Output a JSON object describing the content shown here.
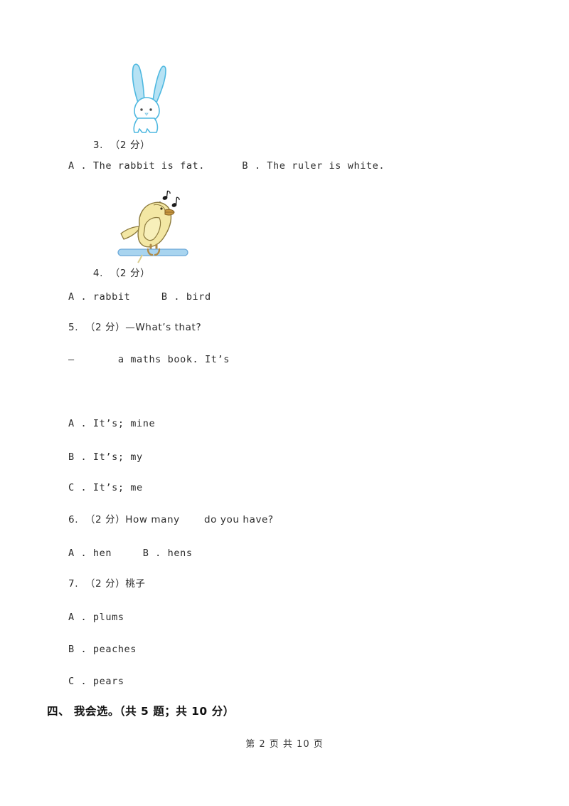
{
  "document": {
    "type": "exam-worksheet",
    "page_background": "#ffffff",
    "text_color": "#2b2b2b"
  },
  "questions": [
    {
      "id": "q3",
      "number": "3.",
      "points": "（2 分）",
      "stem": "",
      "figure": "rabbit-image",
      "options": [
        {
          "label": "A . ",
          "text": "The rabbit is fat."
        },
        {
          "label": "B . ",
          "text": "The ruler is white."
        }
      ],
      "options_inline": "A . The rabbit is fat.      B . The ruler is white."
    },
    {
      "id": "q4",
      "number": "4.",
      "points": "（2 分）",
      "stem": "",
      "figure": "bird-image",
      "options": [
        {
          "label": "A . ",
          "text": "rabbit"
        },
        {
          "label": "B . ",
          "text": "bird"
        }
      ],
      "options_inline": "A . rabbit    B . bird"
    },
    {
      "id": "q5",
      "number": "5.",
      "points": "（2 分）",
      "stem_line1": "—What’s that?",
      "stem_line2": "—      a maths book. It’s",
      "options": [
        {
          "label": "A . ",
          "text": "It’s; mine"
        },
        {
          "label": "B . ",
          "text": "It’s; my"
        },
        {
          "label": "C . ",
          "text": "It’s; me"
        }
      ]
    },
    {
      "id": "q6",
      "number": "6.",
      "points": "（2 分）",
      "stem": "How many      do you have?",
      "options": [
        {
          "label": "A . ",
          "text": "hen"
        },
        {
          "label": "B . ",
          "text": "hens"
        }
      ],
      "options_inline": "A . hen    B . hens"
    },
    {
      "id": "q7",
      "number": "7.",
      "points": "（2 分）",
      "stem": "桃子",
      "options": [
        {
          "label": "A . ",
          "text": "plums"
        },
        {
          "label": "B . ",
          "text": "peaches"
        },
        {
          "label": "C . ",
          "text": "pears"
        }
      ]
    }
  ],
  "lines": {
    "q3_head": "3.  （2 分）",
    "q3_options": "A . The rabbit is fat.      B . The ruler is white.",
    "q4_head": "4.  （2 分）",
    "q4_options": "A . rabbit     B . bird",
    "q5_head": "5.  （2 分）—What’s that?",
    "q5_stem2": "—       a maths book. It’s",
    "q5_optA": "A . It’s; mine",
    "q5_optB": "B . It’s; my",
    "q5_optC": "C . It’s; me",
    "q6_head": "6.  （2 分）How many       do you have?",
    "q6_options": "A . hen     B . hens",
    "q7_head": "7.  （2 分）桃子",
    "q7_optA": "A . plums",
    "q7_optB": "B . peaches",
    "q7_optC": "C . pears"
  },
  "section": {
    "heading": "四、 我会选。（共 5 题；共 10 分）"
  },
  "footer": {
    "text": "第 2 页 共 10 页",
    "current_page": "2",
    "total_pages": "10"
  },
  "figures": {
    "rabbit": {
      "name": "rabbit-image",
      "description": "white rabbit with long blue-tinted ears",
      "outline_color": "#4eb8e0",
      "ear_fill": "#b6e2f4",
      "body_fill": "#ffffff",
      "eye_color": "#4a4a4a"
    },
    "bird": {
      "name": "bird-image",
      "description": "yellow singing bird perched on a blue ruler with music notes",
      "body_fill": "#f3e7a4",
      "body_outline": "#8d7b3e",
      "beak_fill": "#c8963e",
      "perch_fill": "#a8d4ef",
      "perch_outline": "#6aa8d8",
      "note_color": "#1c1c1c",
      "leg_color": "#b08a46"
    }
  }
}
